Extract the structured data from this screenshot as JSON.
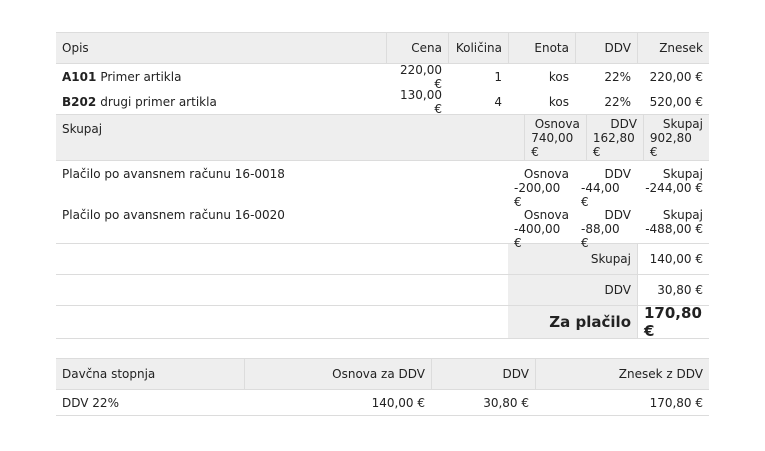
{
  "invoice": {
    "headers": {
      "opis": "Opis",
      "cena": "Cena",
      "kolicina": "Količina",
      "enota": "Enota",
      "ddv": "DDV",
      "znesek": "Znesek"
    },
    "items": [
      {
        "code": "A101",
        "name": "Primer artikla",
        "cena": "220,00 €",
        "kolicina": "1",
        "enota": "kos",
        "ddv": "22%",
        "znesek": "220,00 €"
      },
      {
        "code": "B202",
        "name": "drugi primer artikla",
        "cena": "130,00 €",
        "kolicina": "4",
        "enota": "kos",
        "ddv": "22%",
        "znesek": "520,00 €"
      }
    ],
    "subtotal": {
      "label": "Skupaj",
      "osnova_label": "Osnova",
      "osnova": "740,00 €",
      "ddv_label": "DDV",
      "ddv": "162,80 €",
      "skupaj_label": "Skupaj",
      "skupaj": "902,80 €"
    },
    "advances": [
      {
        "label": "Plačilo po avansnem računu 16-0018",
        "osnova_label": "Osnova",
        "osnova": "-200,00 €",
        "ddv_label": "DDV",
        "ddv": "-44,00 €",
        "skupaj_label": "Skupaj",
        "skupaj": "-244,00 €"
      },
      {
        "label": "Plačilo po avansnem računu 16-0020",
        "osnova_label": "Osnova",
        "osnova": "-400,00 €",
        "ddv_label": "DDV",
        "ddv": "-88,00 €",
        "skupaj_label": "Skupaj",
        "skupaj": "-488,00 €"
      }
    ],
    "totals": {
      "skupaj_label": "Skupaj",
      "skupaj": "140,00 €",
      "ddv_label": "DDV",
      "ddv": "30,80 €",
      "za_placilo_label": "Za plačilo",
      "za_placilo": "170,80 €"
    }
  },
  "vat_table": {
    "headers": {
      "stopnja": "Davčna stopnja",
      "osnova": "Osnova za DDV",
      "ddv": "DDV",
      "znesek": "Znesek z DDV"
    },
    "rows": [
      {
        "stopnja": "DDV 22%",
        "osnova": "140,00 €",
        "ddv": "30,80 €",
        "znesek": "170,80 €"
      }
    ]
  }
}
